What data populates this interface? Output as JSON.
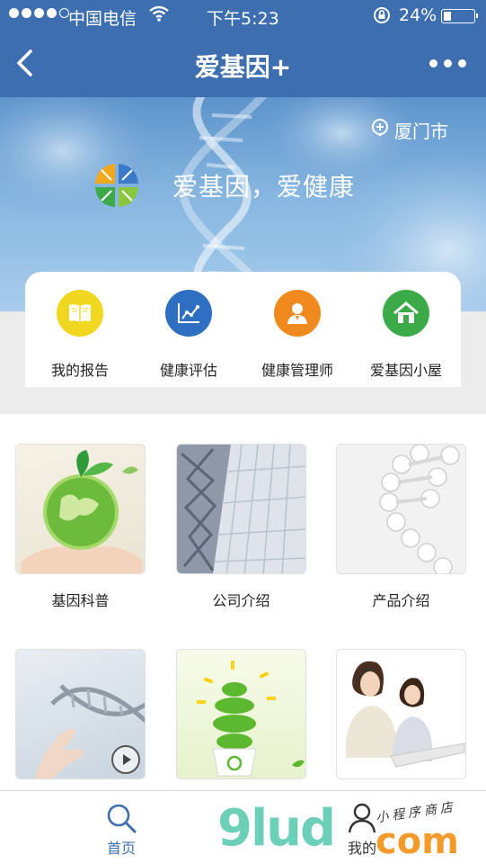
{
  "status_bar": {
    "carrier": "中国电信",
    "time": "下午5:23",
    "battery": "24%",
    "battery_level": 0.24,
    "icons": [
      "signal-dots-icon",
      "wifi-icon",
      "rotation-lock-icon",
      "battery-icon"
    ]
  },
  "nav": {
    "title": "爱基因+",
    "back_icon": "chevron-left-icon",
    "more_icon": "more-dots-icon"
  },
  "hero": {
    "location": "厦门市",
    "location_icon": "location-pin-icon",
    "slogan": "爱基因，爱健康"
  },
  "menu": [
    {
      "label": "我的报告",
      "icon": "book-icon",
      "color": "#f0d820"
    },
    {
      "label": "健康评估",
      "icon": "chart-icon",
      "color": "#2f6fc1"
    },
    {
      "label": "健康管理师",
      "icon": "user-icon",
      "color": "#f08a1e"
    },
    {
      "label": "爱基因小屋",
      "icon": "home-icon",
      "color": "#3daa4a"
    }
  ],
  "tiles": [
    {
      "label": "基因科普",
      "image": "green-earth-in-hands-image"
    },
    {
      "label": "公司介绍",
      "image": "office-building-image"
    },
    {
      "label": "产品介绍",
      "image": "white-dna-helix-image"
    },
    {
      "label": "",
      "image": "dna-video-image"
    },
    {
      "label": "",
      "image": "green-bulb-image"
    },
    {
      "label": "",
      "image": "call-center-staff-image"
    }
  ],
  "tab_bar": {
    "home_label": "首页",
    "home_icon": "search-icon",
    "mine_label": "我的",
    "mine_icon": "person-icon",
    "active_color": "#3d6eb0"
  },
  "watermark": {
    "big": "9lud",
    "com": "com",
    "small": "小程序商店"
  },
  "colors": {
    "primary": "#3d6eb0",
    "gray_band": "#ececec"
  }
}
